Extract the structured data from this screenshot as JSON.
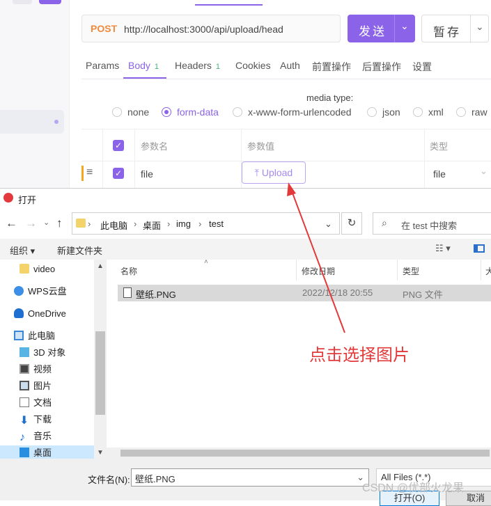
{
  "app": {
    "method": "POST",
    "url": "http://localhost:3000/api/upload/head",
    "send_label": "发送",
    "save_label": "暂存",
    "tabs": [
      {
        "label": "Params",
        "count": ""
      },
      {
        "label": "Body",
        "count": "1"
      },
      {
        "label": "Headers",
        "count": "1"
      },
      {
        "label": "Cookies",
        "count": ""
      },
      {
        "label": "Auth",
        "count": ""
      },
      {
        "label": "前置操作",
        "count": ""
      },
      {
        "label": "后置操作",
        "count": ""
      },
      {
        "label": "设置",
        "count": ""
      }
    ],
    "media_type_label": "media type:",
    "media_types": [
      "none",
      "form-data",
      "x-www-form-urlencoded",
      "json",
      "xml",
      "raw"
    ],
    "selected_media_type": "form-data",
    "table": {
      "headers": [
        "参数名",
        "参数值",
        "类型"
      ],
      "row": {
        "name": "file",
        "value_button": "Upload",
        "type": "file"
      }
    }
  },
  "dialog": {
    "title": "打开",
    "breadcrumb": [
      "此电脑",
      "桌面",
      "img",
      "test"
    ],
    "search_placeholder": "在 test 中搜索",
    "toolbar": {
      "organize": "组织 ▾",
      "new_folder": "新建文件夹"
    },
    "nav_items": [
      "video",
      "WPS云盘",
      "OneDrive",
      "此电脑",
      "3D 对象",
      "视频",
      "图片",
      "文档",
      "下载",
      "音乐",
      "桌面"
    ],
    "columns": [
      "名称",
      "修改日期",
      "类型",
      "大"
    ],
    "files": [
      {
        "name": "壁纸.PNG",
        "date": "2022/12/18 20:55",
        "type": "PNG 文件"
      }
    ],
    "filename_label": "文件名(N):",
    "filename_value": "壁纸.PNG",
    "filter": "All Files (*.*)",
    "open_label": "打开(O)",
    "cancel_label": "取消"
  },
  "annotation": "点击选择图片",
  "watermark": "CSDN @优部火龙果",
  "colors": {
    "accent": "#8a63e8",
    "annotation": "#e23a3a",
    "post": "#f08a3c"
  }
}
